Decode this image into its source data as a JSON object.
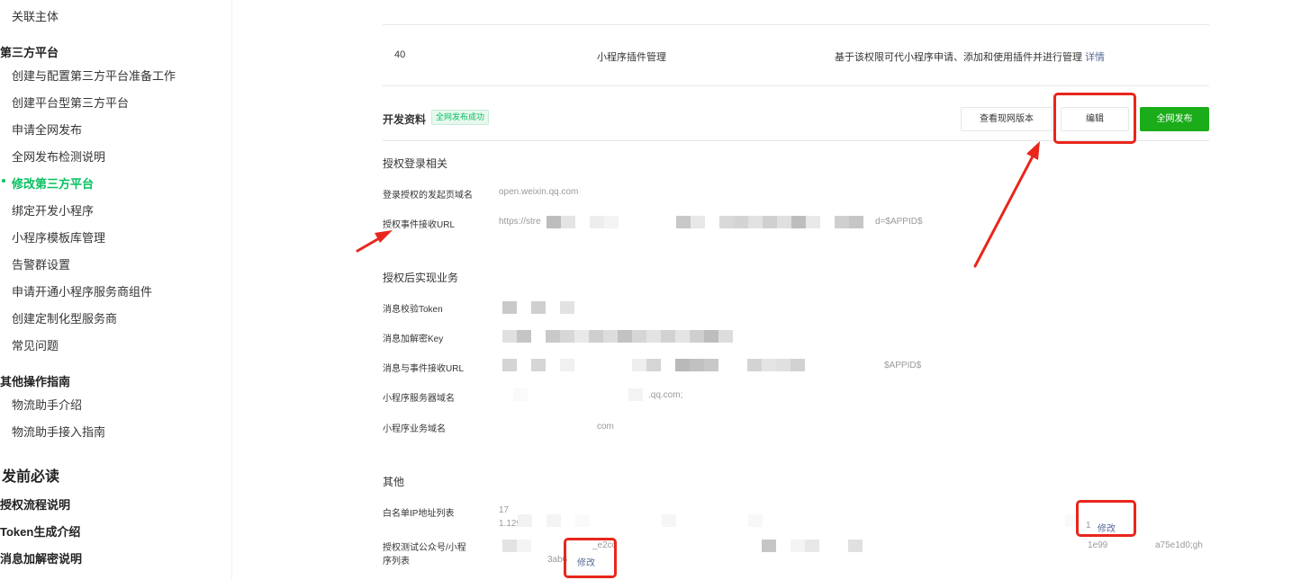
{
  "sidebar": {
    "items": [
      {
        "label": "关联主体",
        "kind": "sub"
      },
      {
        "label": "第三方平台",
        "kind": "head"
      },
      {
        "label": "创建与配置第三方平台准备工作",
        "kind": "sub"
      },
      {
        "label": "创建平台型第三方平台",
        "kind": "sub"
      },
      {
        "label": "申请全网发布",
        "kind": "sub"
      },
      {
        "label": "全网发布检测说明",
        "kind": "sub"
      },
      {
        "label": "修改第三方平台",
        "kind": "active"
      },
      {
        "label": "绑定开发小程序",
        "kind": "sub"
      },
      {
        "label": "小程序模板库管理",
        "kind": "sub"
      },
      {
        "label": "告警群设置",
        "kind": "sub"
      },
      {
        "label": "申请开通小程序服务商组件",
        "kind": "sub"
      },
      {
        "label": "创建定制化型服务商",
        "kind": "sub"
      },
      {
        "label": "常见问题",
        "kind": "sub"
      },
      {
        "label": "其他操作指南",
        "kind": "head"
      },
      {
        "label": "物流助手介绍",
        "kind": "sub"
      },
      {
        "label": "物流助手接入指南",
        "kind": "sub"
      },
      {
        "label": "发前必读",
        "kind": "big"
      },
      {
        "label": "授权流程说明",
        "kind": "bold"
      },
      {
        "label": "Token生成介绍",
        "kind": "bold"
      },
      {
        "label": "消息加解密说明",
        "kind": "bold"
      }
    ]
  },
  "permission_row": {
    "id": "40",
    "name": "小程序插件管理",
    "description": "基于该权限可代小程序申请、添加和使用插件并进行管理",
    "detail_link": "详情"
  },
  "dev_info": {
    "title": "开发资料",
    "status_tag": "全网发布成功",
    "buttons": {
      "view_live": "查看现网版本",
      "edit": "编辑",
      "publish": "全网发布"
    }
  },
  "auth_login": {
    "group_title": "授权登录相关",
    "fields": [
      {
        "label": "登录授权的发起页域名",
        "value": "open.weixin.qq.com"
      },
      {
        "label": "授权事件接收URL",
        "value_prefix": "https://stre",
        "value_suffix": "d=$APPID$"
      }
    ]
  },
  "post_auth": {
    "group_title": "授权后实现业务",
    "fields": [
      {
        "label": "消息校验Token",
        "value": ""
      },
      {
        "label": "消息加解密Key",
        "value": ""
      },
      {
        "label": "消息与事件接收URL",
        "value_suffix": "$APPID$"
      },
      {
        "label": "小程序服务器域名",
        "value_suffix": ".qq.com;"
      },
      {
        "label": "小程序业务域名",
        "value_suffix": "com"
      }
    ]
  },
  "other": {
    "group_title": "其他",
    "whitelist": {
      "label": "白名单IP地址列表",
      "line1": "17",
      "line2": "1.129",
      "tail": "1",
      "edit": "修改"
    },
    "test_accounts": {
      "label_line1": "授权测试公众号/小程",
      "label_line2": "序列表",
      "frag1": "_e2cc",
      "frag2": "1e99",
      "frag3": "a75e1d0;gh",
      "frag4": "3ab6",
      "edit": "修改"
    }
  },
  "colors": {
    "accent_green": "#07c160",
    "button_green": "#1aad19",
    "link_blue": "#576b95",
    "annotation_red": "#e8261c"
  }
}
